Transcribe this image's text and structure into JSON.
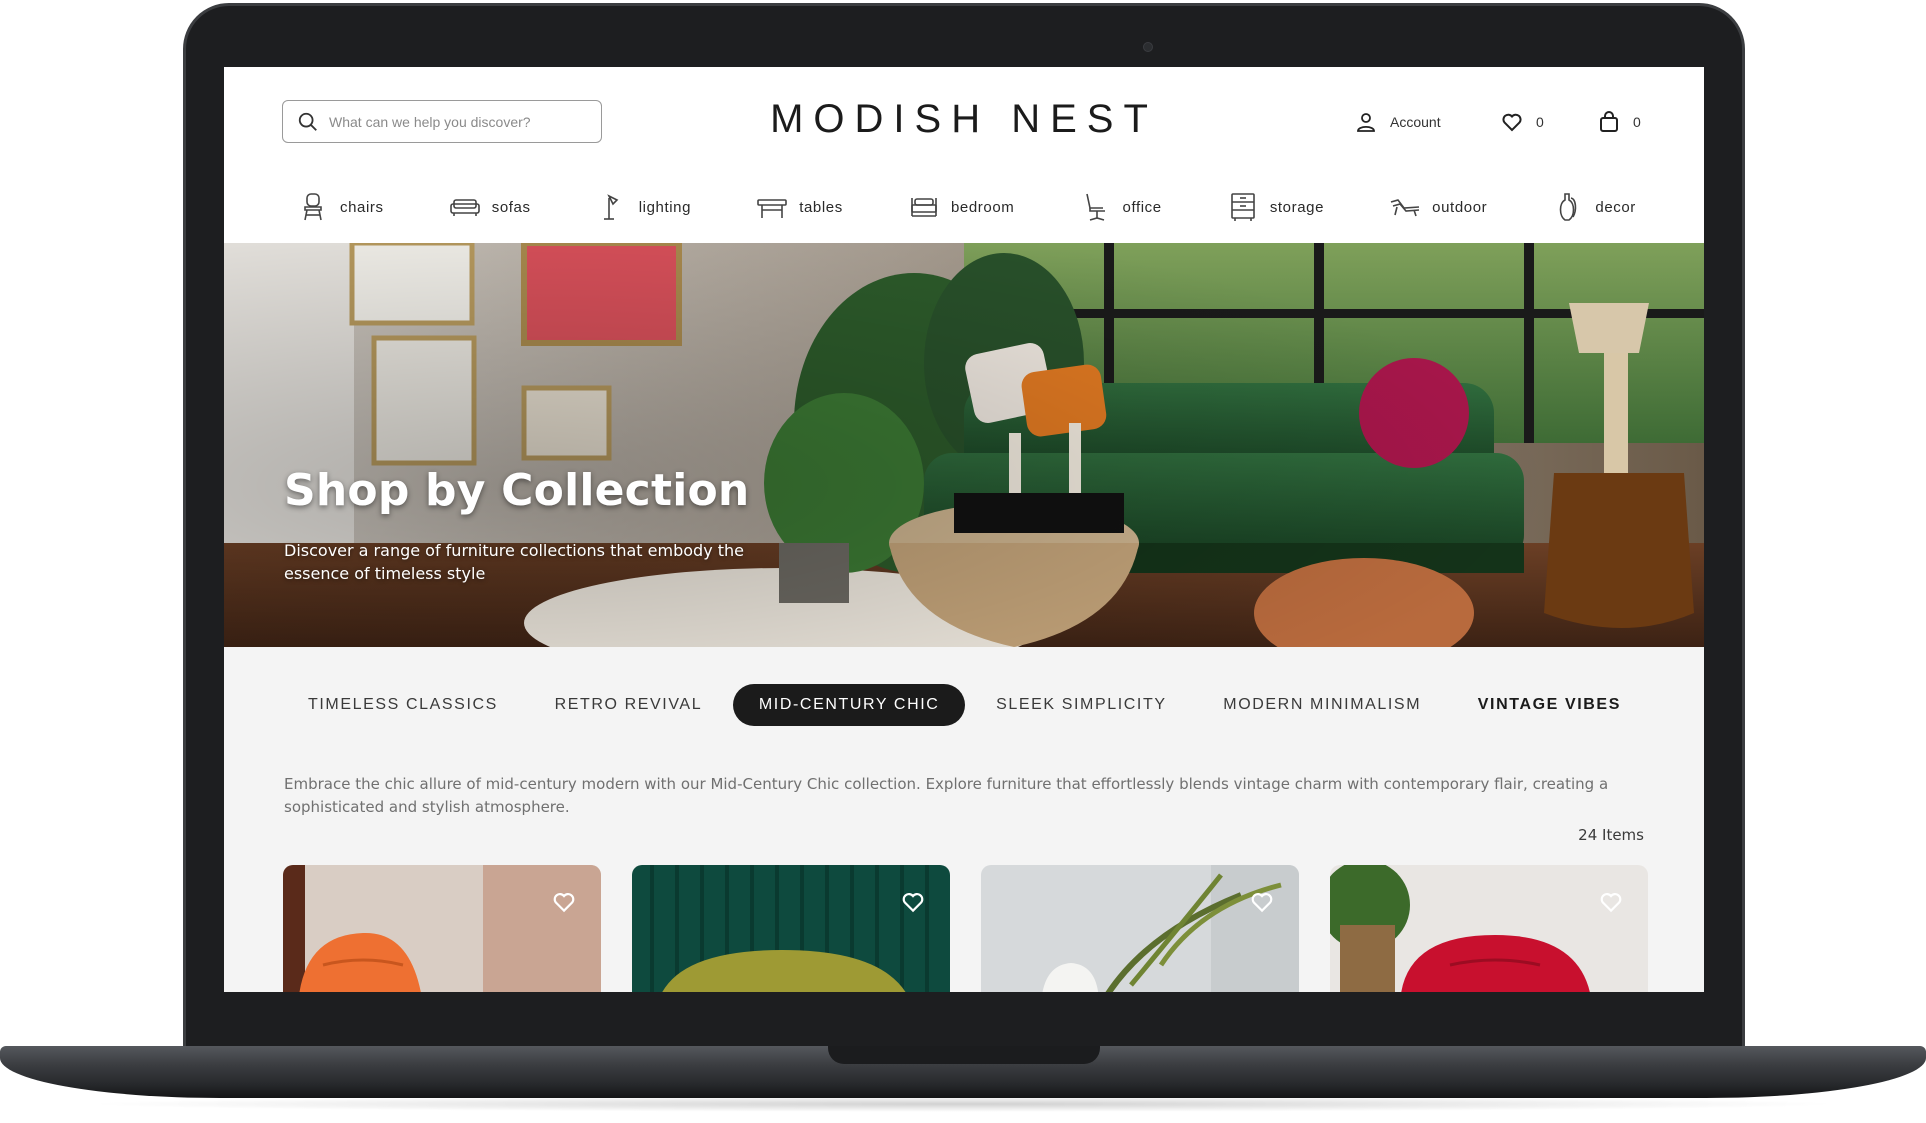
{
  "header": {
    "search_placeholder": "What can we help you discover?",
    "logo": "MODISH NEST",
    "account_label": "Account",
    "wishlist_count": "0",
    "cart_count": "0"
  },
  "categories": [
    {
      "label": "chairs",
      "icon": "chair-icon"
    },
    {
      "label": "sofas",
      "icon": "sofa-icon"
    },
    {
      "label": "lighting",
      "icon": "lamp-icon"
    },
    {
      "label": "tables",
      "icon": "table-icon"
    },
    {
      "label": "bedroom",
      "icon": "bed-icon"
    },
    {
      "label": "office",
      "icon": "office-chair-icon"
    },
    {
      "label": "storage",
      "icon": "cabinet-icon"
    },
    {
      "label": "outdoor",
      "icon": "lounger-icon"
    },
    {
      "label": "decor",
      "icon": "vase-icon"
    }
  ],
  "hero": {
    "title": "Shop by Collection",
    "subtitle": "Discover a range of furniture collections that embody the essence of timeless style"
  },
  "tabs": [
    {
      "label": "TIMELESS CLASSICS",
      "active": false
    },
    {
      "label": "RETRO REVIVAL",
      "active": false
    },
    {
      "label": "MID-CENTURY CHIC",
      "active": true
    },
    {
      "label": "SLEEK SIMPLICITY",
      "active": false
    },
    {
      "label": "MODERN MINIMALISM",
      "active": false
    },
    {
      "label": "VINTAGE VIBES",
      "active": false
    }
  ],
  "collection": {
    "description": "Embrace the chic allure of mid-century modern with our Mid-Century Chic collection. Explore furniture that effortlessly blends vintage charm with contemporary flair, creating a sophisticated and stylish atmosphere.",
    "item_count": "24 Items"
  },
  "colors": {
    "accent_dark": "#1b1b1b",
    "sofa_green": "#2f5a33",
    "screen_bg": "#f4f4f4"
  }
}
